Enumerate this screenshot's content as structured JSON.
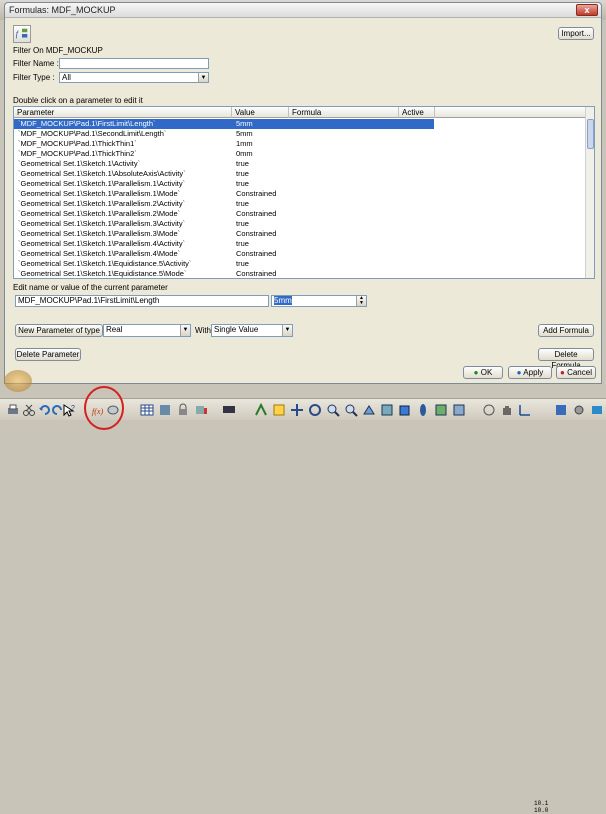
{
  "window": {
    "title": "Formulas: MDF_MOCKUP",
    "close_glyph": "x"
  },
  "top_icon": "formula-toolbar-icon",
  "import_label": "Import...",
  "filter": {
    "heading": "Filter On MDF_MOCKUP",
    "name_label": "Filter Name :",
    "name_value": "",
    "type_label": "Filter Type :",
    "type_value": "All"
  },
  "table": {
    "instruction": "Double click on a parameter to edit it",
    "headers": [
      "Parameter",
      "Value",
      "Formula",
      "Active"
    ],
    "rows": [
      {
        "parameter": "`MDF_MOCKUP\\Pad.1\\FirstLimit\\Length`",
        "value": "5mm",
        "selected": true
      },
      {
        "parameter": "`MDF_MOCKUP\\Pad.1\\SecondLimit\\Length`",
        "value": "5mm"
      },
      {
        "parameter": "`MDF_MOCKUP\\Pad.1\\ThickThin1`",
        "value": "1mm"
      },
      {
        "parameter": "`MDF_MOCKUP\\Pad.1\\ThickThin2`",
        "value": "0mm"
      },
      {
        "parameter": "`Geometrical Set.1\\Sketch.1\\Activity`",
        "value": "true"
      },
      {
        "parameter": "`Geometrical Set.1\\Sketch.1\\AbsoluteAxis\\Activity`",
        "value": "true"
      },
      {
        "parameter": "`Geometrical Set.1\\Sketch.1\\Parallelism.1\\Activity`",
        "value": "true"
      },
      {
        "parameter": "`Geometrical Set.1\\Sketch.1\\Parallelism.1\\Mode`",
        "value": "Constrained"
      },
      {
        "parameter": "`Geometrical Set.1\\Sketch.1\\Parallelism.2\\Activity`",
        "value": "true"
      },
      {
        "parameter": "`Geometrical Set.1\\Sketch.1\\Parallelism.2\\Mode`",
        "value": "Constrained"
      },
      {
        "parameter": "`Geometrical Set.1\\Sketch.1\\Parallelism.3\\Activity`",
        "value": "true"
      },
      {
        "parameter": "`Geometrical Set.1\\Sketch.1\\Parallelism.3\\Mode`",
        "value": "Constrained"
      },
      {
        "parameter": "`Geometrical Set.1\\Sketch.1\\Parallelism.4\\Activity`",
        "value": "true"
      },
      {
        "parameter": "`Geometrical Set.1\\Sketch.1\\Parallelism.4\\Mode`",
        "value": "Constrained"
      },
      {
        "parameter": "`Geometrical Set.1\\Sketch.1\\Equidistance.5\\Activity`",
        "value": "true"
      },
      {
        "parameter": "`Geometrical Set.1\\Sketch.1\\Equidistance.5\\Mode`",
        "value": "Constrained"
      }
    ]
  },
  "edit": {
    "label": "Edit name or value of the current parameter",
    "name_value": "MDF_MOCKUP\\Pad.1\\FirstLimit\\Length",
    "value": "5mm"
  },
  "new_param": {
    "button": "New Parameter of type",
    "type_value": "Real",
    "with_label": "With",
    "with_value": "Single Value"
  },
  "buttons": {
    "add_formula": "Add Formula",
    "delete_parameter": "Delete Parameter",
    "delete_formula": "Delete Formula",
    "ok": "OK",
    "apply": "Apply",
    "cancel": "Cancel"
  },
  "toolbar": {
    "formula_icon_text": "f(x)",
    "axis_label_top": "10.1",
    "axis_label_bottom": "10.0"
  },
  "colors": {
    "selection": "#3169c6",
    "highlight_circle": "#d42020",
    "dialog_bg": "#ece9d8"
  }
}
